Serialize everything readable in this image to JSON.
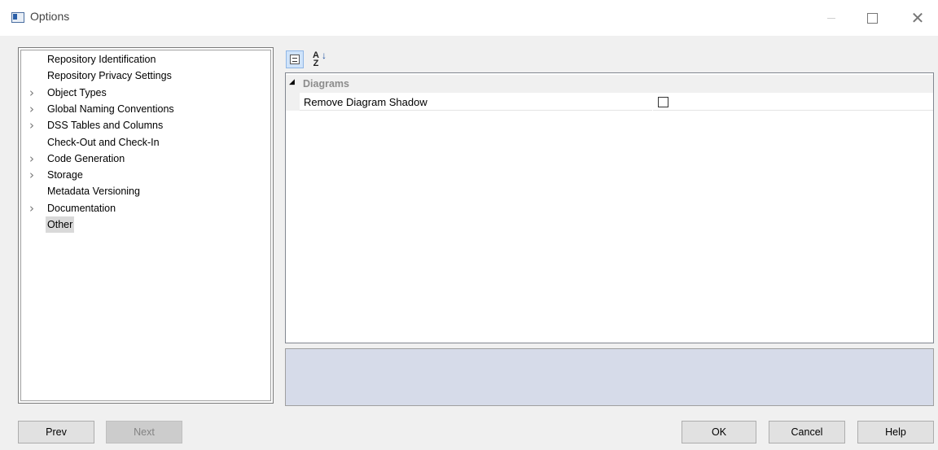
{
  "window": {
    "title": "Options"
  },
  "tree": {
    "items": [
      {
        "label": "Repository Identification",
        "expandable": false,
        "selected": false
      },
      {
        "label": "Repository Privacy Settings",
        "expandable": false,
        "selected": false
      },
      {
        "label": "Object Types",
        "expandable": true,
        "selected": false
      },
      {
        "label": "Global Naming Conventions",
        "expandable": true,
        "selected": false
      },
      {
        "label": "DSS Tables and Columns",
        "expandable": true,
        "selected": false
      },
      {
        "label": "Check-Out and Check-In",
        "expandable": false,
        "selected": false
      },
      {
        "label": "Code Generation",
        "expandable": true,
        "selected": false
      },
      {
        "label": "Storage",
        "expandable": true,
        "selected": false
      },
      {
        "label": "Metadata Versioning",
        "expandable": false,
        "selected": false
      },
      {
        "label": "Documentation",
        "expandable": true,
        "selected": false
      },
      {
        "label": "Other",
        "expandable": false,
        "selected": true
      }
    ]
  },
  "toolbar": {
    "categorized_icon": "categorized-view-icon",
    "alphabetical_icon": "sort-alphabetical-icon",
    "alphabetical_glyph_top": "A",
    "alphabetical_glyph_bottom": "Z"
  },
  "property_grid": {
    "category": {
      "label": "Diagrams",
      "expanded": true
    },
    "properties": [
      {
        "name": "Remove Diagram Shadow",
        "value": false
      }
    ]
  },
  "buttons": {
    "prev": "Prev",
    "next": "Next",
    "ok": "OK",
    "cancel": "Cancel",
    "help": "Help"
  },
  "colors": {
    "selection": "#d9d9d9",
    "description_panel": "#d6dbe9",
    "toolbar_active": "#cfe3fa"
  }
}
